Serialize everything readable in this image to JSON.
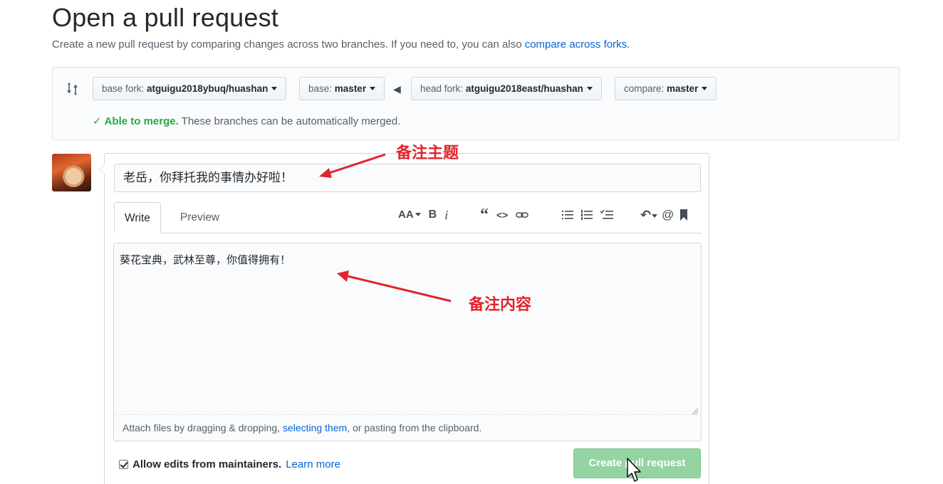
{
  "header": {
    "title": "Open a pull request",
    "desc_prefix": "Create a new pull request by comparing changes across two branches. If you need to, you can also ",
    "desc_link": "compare across forks",
    "desc_suffix": "."
  },
  "range": {
    "base_fork_label": "base fork:",
    "base_fork_value": "atguigu2018ybuq/huashan",
    "base_label": "base:",
    "base_value": "master",
    "head_fork_label": "head fork:",
    "head_fork_value": "atguigu2018east/huashan",
    "compare_label": "compare:",
    "compare_value": "master",
    "merge_ok": "Able to merge.",
    "merge_text": " These branches can be automatically merged."
  },
  "form": {
    "title_value": "老岳，你拜托我的事情办好啦！",
    "tabs": [
      "Write",
      "Preview"
    ],
    "toolbar": {
      "text_size": "AA",
      "bold": "B",
      "italic": "i",
      "quote": "“",
      "code": "<>",
      "reply": "↶",
      "mention": "@"
    },
    "body_value": "葵花宝典，武林至尊，你值得拥有！",
    "attach_prefix": "Attach files by dragging & dropping, ",
    "attach_link": "selecting them",
    "attach_suffix": ", or pasting from the clipboard.",
    "allow_edits_label": "Allow edits from maintainers.",
    "learn_more": "Learn more",
    "allow_edits_checked": true,
    "create_button": "Create pull request"
  },
  "annotations": {
    "title_note": "备注主题",
    "body_note": "备注内容"
  },
  "colors": {
    "link": "#0366d6",
    "success": "#28a745",
    "create_button_disabled": "#94d3a2",
    "annotation": "#e0252b"
  }
}
